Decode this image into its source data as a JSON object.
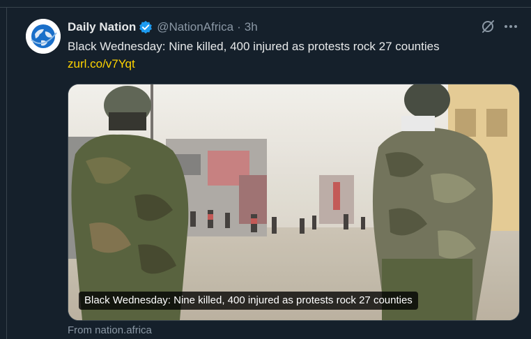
{
  "tweet": {
    "display_name": "Daily Nation",
    "handle": "@NationAfrica",
    "separator": "·",
    "time": "3h",
    "text": "Black Wednesday: Nine killed, 400 injured as protests rock 27 counties",
    "link": "zurl.co/v7Yqt"
  },
  "card": {
    "caption": "Black Wednesday: Nine killed, 400 injured as protests rock 27 counties",
    "source": "From nation.africa"
  },
  "icons": {
    "avatar": "globe-logo",
    "verified": "verified-badge-icon",
    "grok": "grok-icon",
    "more": "more-icon"
  },
  "colors": {
    "background": "#15202b",
    "text": "#e7e9ea",
    "muted": "#8b98a5",
    "link": "#ffd400",
    "verified": "#1d9bf0"
  }
}
